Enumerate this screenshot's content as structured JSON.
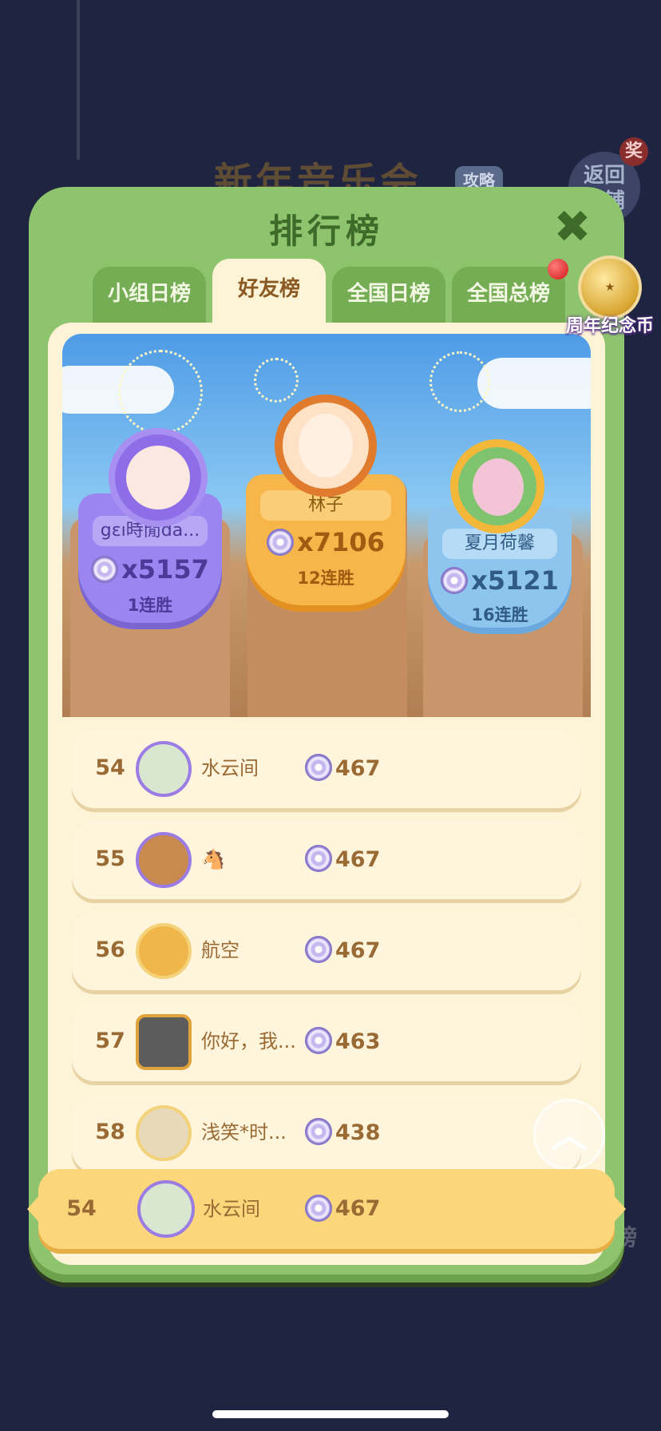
{
  "background": {
    "event_title": "新年音乐会",
    "tag": "攻略",
    "back_label": "返回\n店铺",
    "prize_badge": "奖",
    "side_label": "排行榜"
  },
  "panel": {
    "title": "排行榜",
    "close_icon": "close-icon"
  },
  "tabs": [
    {
      "label": "小组日榜",
      "active": false
    },
    {
      "label": "好友榜",
      "active": true
    },
    {
      "label": "全国日榜",
      "active": false
    },
    {
      "label": "全国总榜",
      "active": false,
      "notification": true
    }
  ],
  "anniversary_coin": {
    "label": "周年纪念币",
    "icon": "coin-icon"
  },
  "podium": {
    "first": {
      "name": "林子",
      "score": "x7106",
      "streak": "12连胜"
    },
    "second": {
      "name": "gɛı時閒da...",
      "score": "x5157",
      "streak": "1连胜"
    },
    "third": {
      "name": "夏月荷馨",
      "score": "x5121",
      "streak": "16连胜"
    }
  },
  "list": [
    {
      "rank": "54",
      "name": "水云间",
      "score": "467"
    },
    {
      "rank": "55",
      "name": "🐴",
      "score": "467"
    },
    {
      "rank": "56",
      "name": "航空",
      "score": "467"
    },
    {
      "rank": "57",
      "name": "你好，我...",
      "score": "463"
    },
    {
      "rank": "58",
      "name": "浅笑*时...",
      "score": "438"
    }
  ],
  "self_row": {
    "rank": "54",
    "name": "水云间",
    "score": "467"
  },
  "colors": {
    "panel_green": "#8fc46e",
    "cream": "#fdf3d6",
    "gold": "#fbd67a",
    "purple": "#9b86f1",
    "blue": "#8ec5ef"
  }
}
